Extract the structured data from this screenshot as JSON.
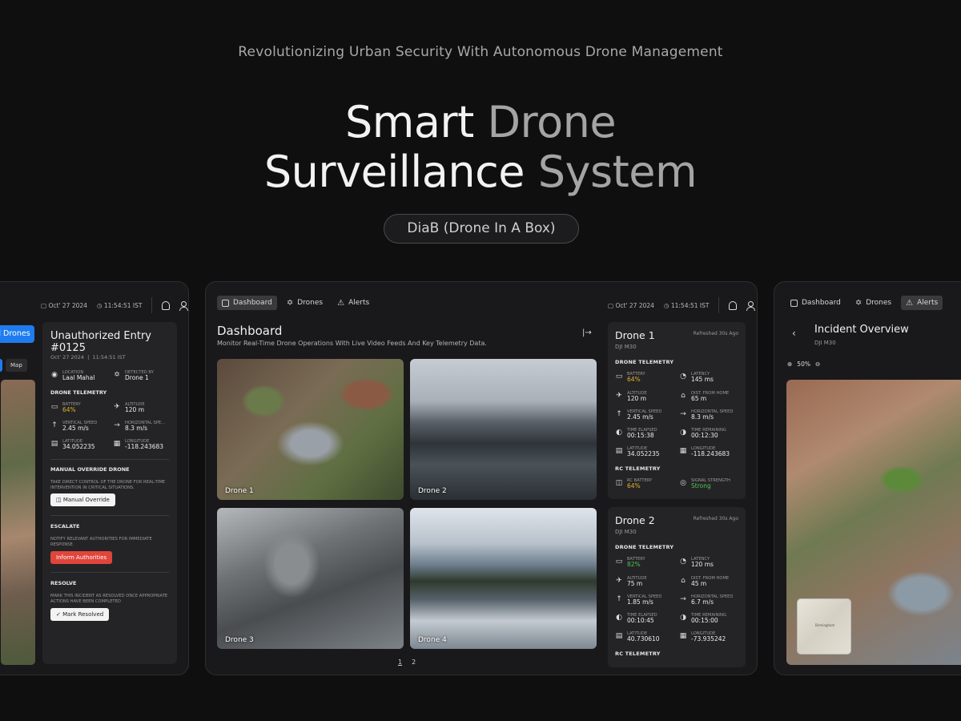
{
  "hero": {
    "subtitle": "Revolutionizing Urban Security With Autonomous Drone Management",
    "title_line1_a": "Smart",
    "title_line1_b": "Drone",
    "title_line2_a": "Surveillance",
    "title_line2_b": "System",
    "pill": "DiaB (Drone In A Box)"
  },
  "nav": {
    "dashboard": "Dashboard",
    "drones": "Drones",
    "alerts": "Alerts"
  },
  "topbar": {
    "date": "Oct' 27 2024",
    "time": "11:54:51 IST"
  },
  "dashboard": {
    "title": "Dashboard",
    "description": "Monitor Real-Time Drone Operations With Live Video Feeds And Key Telemetry Data.",
    "feeds": [
      "Drone 1",
      "Drone 2",
      "Drone 3",
      "Drone 4"
    ],
    "pages": [
      "1",
      "2"
    ]
  },
  "drone_cards": [
    {
      "name": "Drone 1",
      "refreshed": "Refreshed 30s Ago",
      "model": "DJI M30",
      "telemetry_title": "DRONE TELEMETRY",
      "metrics": [
        {
          "label": "BATTERY",
          "value": "64%"
        },
        {
          "label": "LATENCY",
          "value": "145 ms"
        },
        {
          "label": "ALTITUDE",
          "value": "120 m"
        },
        {
          "label": "DIST. FROM HOME",
          "value": "65 m"
        },
        {
          "label": "VERTICAL SPEED",
          "value": "2.45 m/s"
        },
        {
          "label": "HORIZONTAL SPEED",
          "value": "8.3 m/s"
        },
        {
          "label": "TIME ELAPSED",
          "value": "00:15:38"
        },
        {
          "label": "TIME REMAINING",
          "value": "00:12:30"
        },
        {
          "label": "LATITUDE",
          "value": "34.052235"
        },
        {
          "label": "LONGITUDE",
          "value": "-118.243683"
        }
      ],
      "rc_title": "RC TELEMETRY",
      "rc": [
        {
          "label": "RC BATTERY",
          "value": "64%"
        },
        {
          "label": "SIGNAL STRENGTH",
          "value": "Strong"
        }
      ]
    },
    {
      "name": "Drone 2",
      "refreshed": "Refreshed 30s Ago",
      "model": "DJI M30",
      "telemetry_title": "DRONE TELEMETRY",
      "metrics": [
        {
          "label": "BATTERY",
          "value": "82%"
        },
        {
          "label": "LATENCY",
          "value": "120 ms"
        },
        {
          "label": "ALTITUDE",
          "value": "75 m"
        },
        {
          "label": "DIST. FROM HOME",
          "value": "45 m"
        },
        {
          "label": "VERTICAL SPEED",
          "value": "1.85 m/s"
        },
        {
          "label": "HORIZONTAL SPEED",
          "value": "6.7 m/s"
        },
        {
          "label": "TIME ELAPSED",
          "value": "00:10:45"
        },
        {
          "label": "TIME REMAINING",
          "value": "00:15:00"
        },
        {
          "label": "LATITUDE",
          "value": "40.730610"
        },
        {
          "label": "LONGITUDE",
          "value": "-73.935242"
        }
      ],
      "rc_title": "RC TELEMETRY"
    }
  ],
  "incident": {
    "title": "Unauthorized Entry #0125",
    "date": "Oct' 27 2024",
    "time": "11:54:51 IST",
    "location_label": "LOCATION",
    "location": "Laal Mahal",
    "detected_label": "DETECTED BY",
    "detected": "Drone 1",
    "telemetry_title": "DRONE TELEMETRY",
    "metrics": [
      {
        "label": "BATTERY",
        "value": "64%"
      },
      {
        "label": "ALTITUDE",
        "value": "120 m"
      },
      {
        "label": "VERTICAL SPEED",
        "value": "2.45 m/s"
      },
      {
        "label": "HORIZONTAL SPE...",
        "value": "8.3 m/s"
      },
      {
        "label": "LATITUDE",
        "value": "34.052235"
      },
      {
        "label": "LONGITUDE",
        "value": "-118.243683"
      }
    ],
    "override_title": "MANUAL OVERRIDE DRONE",
    "override_desc": "TAKE DIRECT CONTROL OF THE DRONE FOR REAL-TIME INTERVENTION IN CRITICAL SITUATIONS.",
    "override_btn": "Manual Override",
    "escalate_title": "ESCALATE",
    "escalate_desc": "NOTIFY RELEVANT AUTHORITIES FOR IMMEDIATE RESPONSE.",
    "escalate_btn": "Inform Authorities",
    "resolve_title": "RESOLVE",
    "resolve_desc": "MARK THIS INCIDENT AS RESOLVED ONCE APPROPRIATE ACTIONS HAVE BEEN COMPLETED",
    "resolve_btn": "Mark Resolved",
    "side_button": "d Drones",
    "map_tab": "Map"
  },
  "overview": {
    "title": "Incident Overview",
    "model": "DJI M30",
    "zoom": "50%",
    "mini_map_label": "Birmingham"
  }
}
